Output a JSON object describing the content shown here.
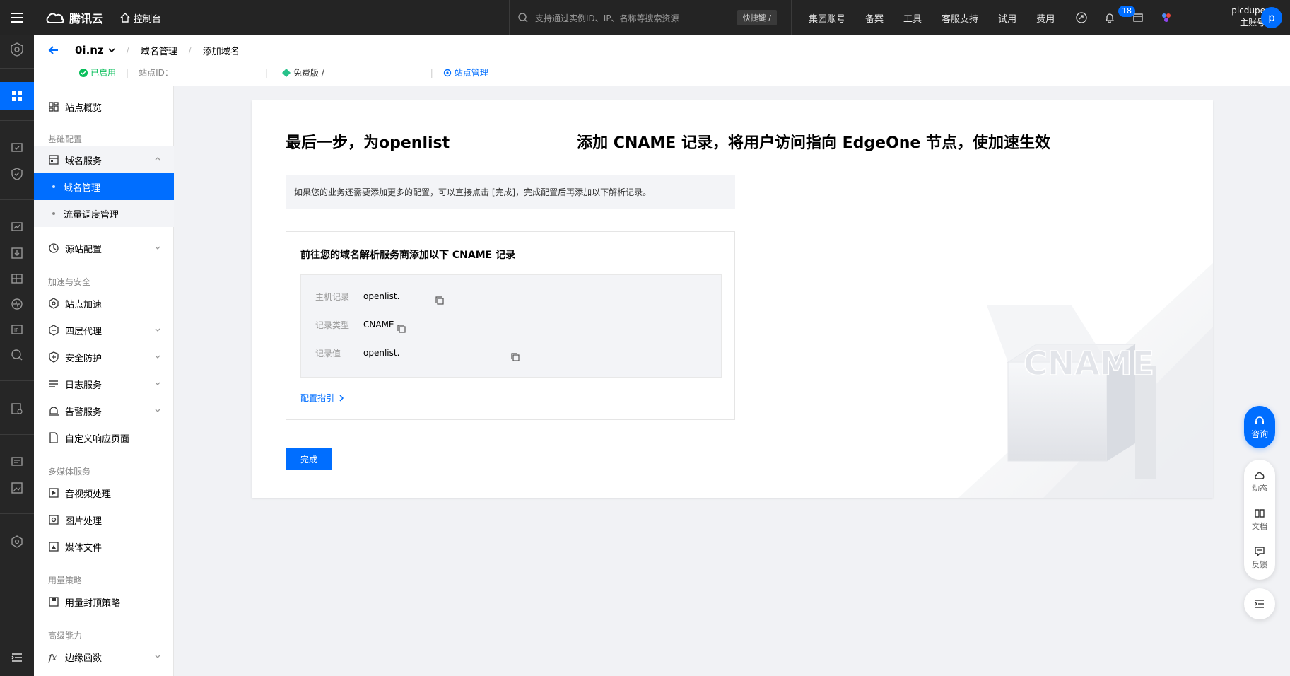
{
  "topbar": {
    "brand": "腾讯云",
    "console": "控制台",
    "search_placeholder": "支持通过实例ID、IP、名称等搜索资源",
    "shortcut": "快捷键 /",
    "links": [
      "集团账号",
      "备案",
      "工具",
      "客服支持",
      "试用",
      "费用"
    ],
    "notification_count": "18",
    "user_name": "picdupe",
    "account_type": "主账号",
    "avatar_letter": "p"
  },
  "header": {
    "site": "0i.nz",
    "crumb1": "域名管理",
    "crumb2": "添加域名",
    "status": "已启用",
    "site_id_label": "站点ID：",
    "plan": "免费版 /",
    "site_manage": "站点管理"
  },
  "subnav": {
    "overview": "站点概览",
    "group_basic": "基础配置",
    "domain_service": "域名服务",
    "domain_manage": "域名管理",
    "traffic": "流量调度管理",
    "origin": "源站配置",
    "group_accel": "加速与安全",
    "site_accel": "站点加速",
    "l4proxy": "四层代理",
    "security": "安全防护",
    "log": "日志服务",
    "alarm": "告警服务",
    "custom_page": "自定义响应页面",
    "group_media": "多媒体服务",
    "av": "音视频处理",
    "image": "图片处理",
    "media_file": "媒体文件",
    "group_usage": "用量策略",
    "usage_cap": "用量封顶策略",
    "group_adv": "高级能力",
    "edge_func": "边缘函数"
  },
  "main": {
    "title_left": "最后一步，为openlist",
    "title_right": "添加 CNAME 记录，将用户访问指向 EdgeOne 节点，使加速生效",
    "notice": "如果您的业务还需要添加更多的配置，可以直接点击 [完成]，完成配置后再添加以下解析记录。",
    "records_title": "前往您的域名解析服务商添加以下 CNAME 记录",
    "host_label": "主机记录",
    "host_value": "openlist.",
    "type_label": "记录类型",
    "type_value": "CNAME",
    "value_label": "记录值",
    "value_value": "openlist.",
    "guide": "配置指引",
    "done": "完成",
    "illus_text": "CNAME"
  },
  "float": {
    "consult": "咨询",
    "dynamic": "动态",
    "docs": "文档",
    "feedback": "反馈"
  }
}
